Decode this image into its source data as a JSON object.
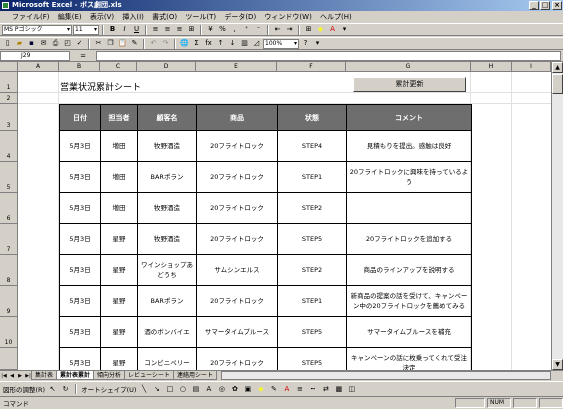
{
  "window": {
    "title": "Microsoft Excel - ボス劇団.xls"
  },
  "menu": [
    "ファイル(F)",
    "編集(E)",
    "表示(V)",
    "挿入(I)",
    "書式(O)",
    "ツール(T)",
    "データ(D)",
    "ウィンドウ(W)",
    "ヘルプ(H)"
  ],
  "format_toolbar": {
    "font": "MS Pゴシック",
    "size": "11"
  },
  "std_toolbar": {
    "zoom": "100%"
  },
  "formula_bar": {
    "name_box": "J29",
    "fx": "="
  },
  "columns": [
    "A",
    "B",
    "C",
    "D",
    "E",
    "F",
    "G",
    "H",
    "I"
  ],
  "rows": [
    "1",
    "2",
    "3",
    "4",
    "5",
    "6",
    "7",
    "8",
    "9",
    "10"
  ],
  "sheet": {
    "title": "営業状況累計シート",
    "update_button": "累計更新",
    "headers": [
      "日付",
      "担当者",
      "顧客名",
      "商品",
      "状態",
      "コメント"
    ],
    "records": [
      [
        "5月3日",
        "増田",
        "牧野酒造",
        "20フライトロック",
        "STEP4",
        "見積もりを提出。感触は良好"
      ],
      [
        "5月3日",
        "増田",
        "BARポラン",
        "20フライトロック",
        "STEP1",
        "20フライトロックに興味を持っているよう"
      ],
      [
        "5月3日",
        "増田",
        "牧野酒造",
        "20フライトロック",
        "STEP2",
        ""
      ],
      [
        "5月3日",
        "星野",
        "牧野酒造",
        "20フライトロック",
        "STEP5",
        "20フライトロックを追加する"
      ],
      [
        "5月3日",
        "星野",
        "ワインショップあどうち",
        "サムシンエルス",
        "STEP2",
        "商品のラインアップを説明する"
      ],
      [
        "5月3日",
        "星野",
        "BARポラン",
        "20フライトロック",
        "STEP1",
        "新商品の提案の話を受けて、キャンペーン中の20フライトロックを薦めてみる"
      ],
      [
        "5月3日",
        "星野",
        "酒のボンバイエ",
        "サマータイムブルース",
        "STEP5",
        "サマータイムブルースを補充"
      ],
      [
        "5月3日",
        "星野",
        "コンビニペリー",
        "20フライトロック",
        "STEP5",
        "キャンペーンの話に枚乗ってくれて受注決定"
      ]
    ]
  },
  "sheet_tabs": [
    "集計表",
    "累計表累計",
    "傾向分析",
    "レビューシート",
    "連絡用シート"
  ],
  "drawing_toolbar": {
    "draw": "図形の調整(R)",
    "autoshape": "オートシェイプ(U)"
  },
  "status": {
    "mode": "コマンド",
    "num": "NUM"
  }
}
